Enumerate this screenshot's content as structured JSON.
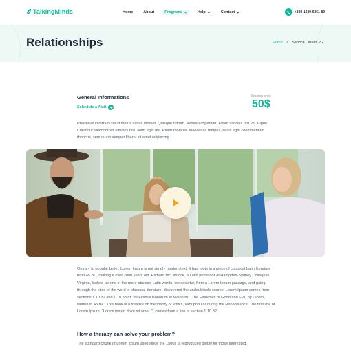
{
  "brand": {
    "name": "TalkingMinds",
    "accent": "#16b59b"
  },
  "nav": {
    "items": [
      {
        "label": "Home",
        "dropdown": false
      },
      {
        "label": "About",
        "dropdown": false
      },
      {
        "label": "Programs",
        "dropdown": true,
        "active": true
      },
      {
        "label": "Help",
        "dropdown": true
      },
      {
        "label": "Contact",
        "dropdown": true
      }
    ],
    "phone": "+880-1680-6361-89"
  },
  "hero": {
    "title": "Relationships",
    "breadcrumb": {
      "home": "Home",
      "separator": ">",
      "current": "Service Details V.2"
    }
  },
  "info": {
    "title": "General Informations",
    "schedule_label": "Schedule a Aisit",
    "price_label": "Session price",
    "price_value": "50$",
    "intro": "Phasellus viverra nulla ut metus varius laoreet. Quisque rutrum. Aenean imperdiet. Etiam ultricies nisi vel augue. Curabitur ullamcorper ultricies nisi. Nam eget dui. Etiam rhoncus. Maecenas tempus, tellus eget condimentum rhoncus, sem quam semper libero, sit amet adipiscing"
  },
  "video": {
    "icon": "play-icon"
  },
  "content": {
    "paragraph": "Ontrary to popular belief, Lorem Ipsum is not simply random text. It has roots in a piece of classical Latin literature from 45 BC, making it over 2000 years old. Richard McClintock, a Latin professor at Hampden-Sydney College in Virginia, looked up one of the more obscure Latin words, consectetur, from a Lorem Ipsum passage, and going through the cites of the word in classical literature, discovered the undoubtable source. Lorem Ipsum comes from sections 1.10.32 and 1.10.33 of \"de Finibus Bonorum et Malorum\" (The Extremes of Good and Evil) by Cicero, written in 45 BC. This book is a treatise on the theory of ethics, very popular during the Renaissance. The first line of Lorem Ipsum, \"Lorem ipsum dolor sit amet..\", comes from a line in section 1.10.32.",
    "section_title": "How a therapy can solve your problem?",
    "section_text": "The standard chunk of Lorem Ipsum used since the 1500s is reproduced below for those interested."
  }
}
